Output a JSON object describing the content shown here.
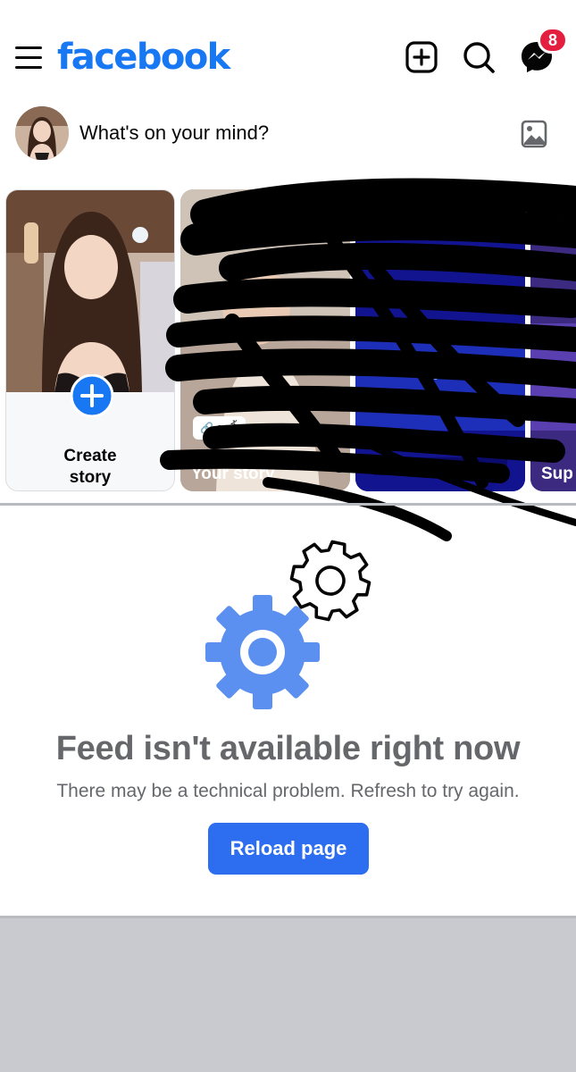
{
  "colors": {
    "brand_blue": "#1877f2",
    "button_blue": "#2d6ef0",
    "badge_red": "#e41e3f",
    "gear_blue": "#5b90f0",
    "muted_text": "#65676b",
    "title_text": "#65676b"
  },
  "header": {
    "logo": "facebook",
    "messenger_badge": "8",
    "icons": [
      "menu-icon",
      "create-post-icon",
      "search-icon",
      "messenger-icon"
    ]
  },
  "composer": {
    "prompt": "What's on your mind?",
    "icons": [
      "avatar",
      "photo-icon"
    ]
  },
  "stories": {
    "create_label_line1": "Create",
    "create_label_line2": "story",
    "your_story_label": "Your story",
    "link_chip": "กดลิ้",
    "fourth_story_label": "Sup"
  },
  "feed_error": {
    "title": "Feed isn't available right now",
    "subtitle": "There may be a technical problem. Refresh to try again.",
    "reload_button": "Reload page",
    "icons": [
      "gear-icon",
      "gear-outline-icon"
    ]
  }
}
